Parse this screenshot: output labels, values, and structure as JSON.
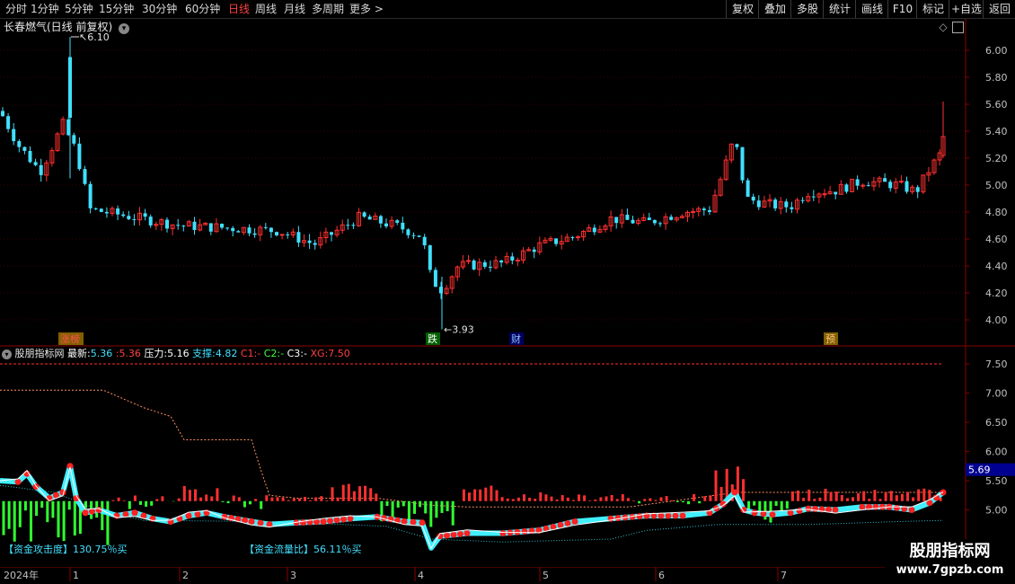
{
  "toolbar": {
    "periods": [
      "分时",
      "1分钟",
      "5分钟",
      "15分钟",
      "30分钟",
      "60分钟",
      "日线",
      "周线",
      "月线",
      "多周期",
      "更多 >"
    ],
    "active": "日线",
    "right_buttons": [
      "复权",
      "叠加",
      "多股",
      "统计",
      "画线",
      "F10",
      "标记",
      "+自选",
      "返回"
    ]
  },
  "main_chart": {
    "title": "长春燃气(日线 前复权)",
    "yaxis_labels": [
      "6.00",
      "5.80",
      "5.60",
      "5.40",
      "5.20",
      "5.00",
      "4.80",
      "4.60",
      "4.40",
      "4.20",
      "4.00"
    ],
    "high_label": "6.10",
    "low_label": "3.93",
    "events": [
      "涨榜",
      "跌",
      "财",
      "预"
    ],
    "colors": {
      "up": "#ff3030",
      "down": "#40e0ff",
      "grid": "#3a0000",
      "axis_text": "#c0c0c0"
    }
  },
  "indicator": {
    "name": "股朋指标网",
    "latest_label": "最新:",
    "latest1": "5.36",
    "latest2": "5.36",
    "pressure_label": "压力:",
    "pressure": "5.16",
    "support_label": "支撑:",
    "support": "4.82",
    "c1_label": "C1:",
    "c1": "-",
    "c2_label": "C2:",
    "c2": "-",
    "c3_label": "C3:",
    "c3": "-",
    "xg_label": "XG:",
    "xg": "7.50",
    "yaxis_labels": [
      "7.50",
      "7.00",
      "6.50",
      "6.00",
      "5.50",
      "5.00"
    ],
    "current_value": "5.69",
    "attack_text": "【资金攻击度】130.75％买",
    "flow_text": "【资金流量比】56.11％买"
  },
  "xaxis": {
    "year_label": "2024年",
    "months": [
      "1",
      "2",
      "3",
      "4",
      "5",
      "6",
      "7"
    ]
  },
  "watermark": {
    "line1": "股朋指标网",
    "line2": "www.7gpzb.com"
  }
}
